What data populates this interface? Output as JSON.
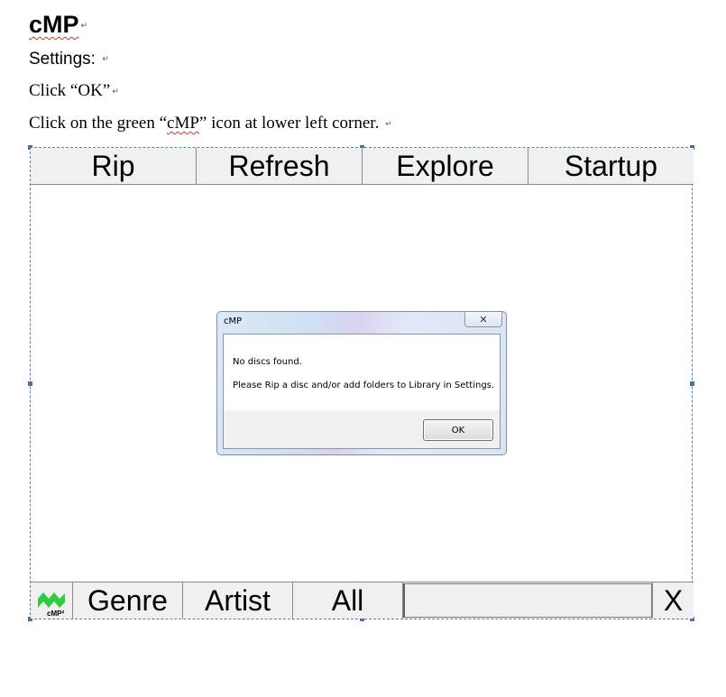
{
  "document": {
    "title": "cMP",
    "line_settings": "Settings:",
    "line_ok": "Click “OK”",
    "line_green_pre": "Click on the green “",
    "line_green_word": "cMP",
    "line_green_post": "” icon at lower left corner.",
    "para_mark": "↵"
  },
  "app": {
    "top_buttons": [
      "Rip",
      "Refresh",
      "Explore",
      "Startup"
    ],
    "bottom_buttons": [
      "Genre",
      "Artist",
      "All"
    ],
    "close_label": "X",
    "logo_text": "cMP²",
    "logo_color": "#2ecc40"
  },
  "dialog": {
    "title": "cMP",
    "close_glyph": "✕",
    "message_1": "No discs found.",
    "message_2": "Please Rip a disc and/or add folders to Library in Settings.",
    "ok_label": "OK"
  }
}
